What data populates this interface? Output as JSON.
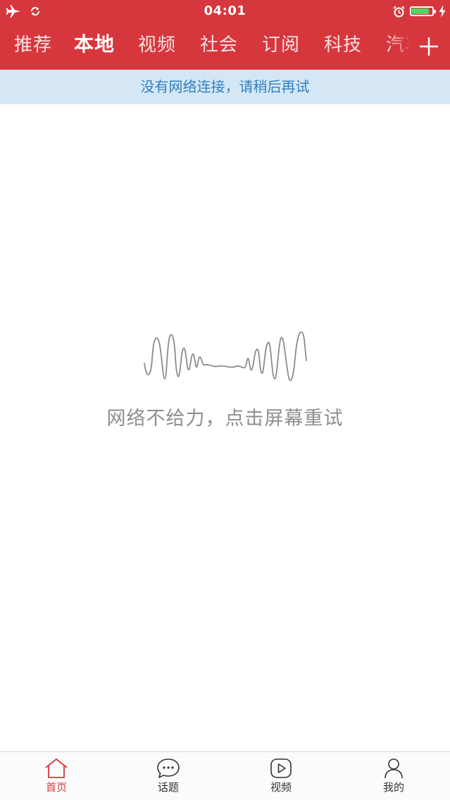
{
  "status_bar": {
    "time": "04:01",
    "icons": [
      "airplane-icon",
      "sync-icon",
      "alarm-icon",
      "battery-icon",
      "charging-icon"
    ],
    "battery_color": "#4cd964",
    "battery_level": 0.85
  },
  "channels": [
    {
      "label": "推荐",
      "active": false
    },
    {
      "label": "本地",
      "active": true
    },
    {
      "label": "视频",
      "active": false
    },
    {
      "label": "社会",
      "active": false
    },
    {
      "label": "订阅",
      "active": false
    },
    {
      "label": "科技",
      "active": false
    },
    {
      "label": "汽车",
      "active": false
    }
  ],
  "add_channel_icon": "plus-icon",
  "notice": {
    "text": "没有网络连接，请稍后再试"
  },
  "error_state": {
    "icon": "signal-wave-icon",
    "message": "网络不给力，点击屏幕重试"
  },
  "tabbar": {
    "items": [
      {
        "label": "首页",
        "icon": "home-icon",
        "active": true
      },
      {
        "label": "话题",
        "icon": "chat-bubble-icon",
        "active": false
      },
      {
        "label": "视频",
        "icon": "play-icon",
        "active": false
      },
      {
        "label": "我的",
        "icon": "user-icon",
        "active": false
      }
    ]
  },
  "colors": {
    "brand_red": "#d6373d",
    "notice_bg": "#d5e7f5",
    "notice_text": "#2f7fc2",
    "muted_text": "#8e8e8e"
  }
}
